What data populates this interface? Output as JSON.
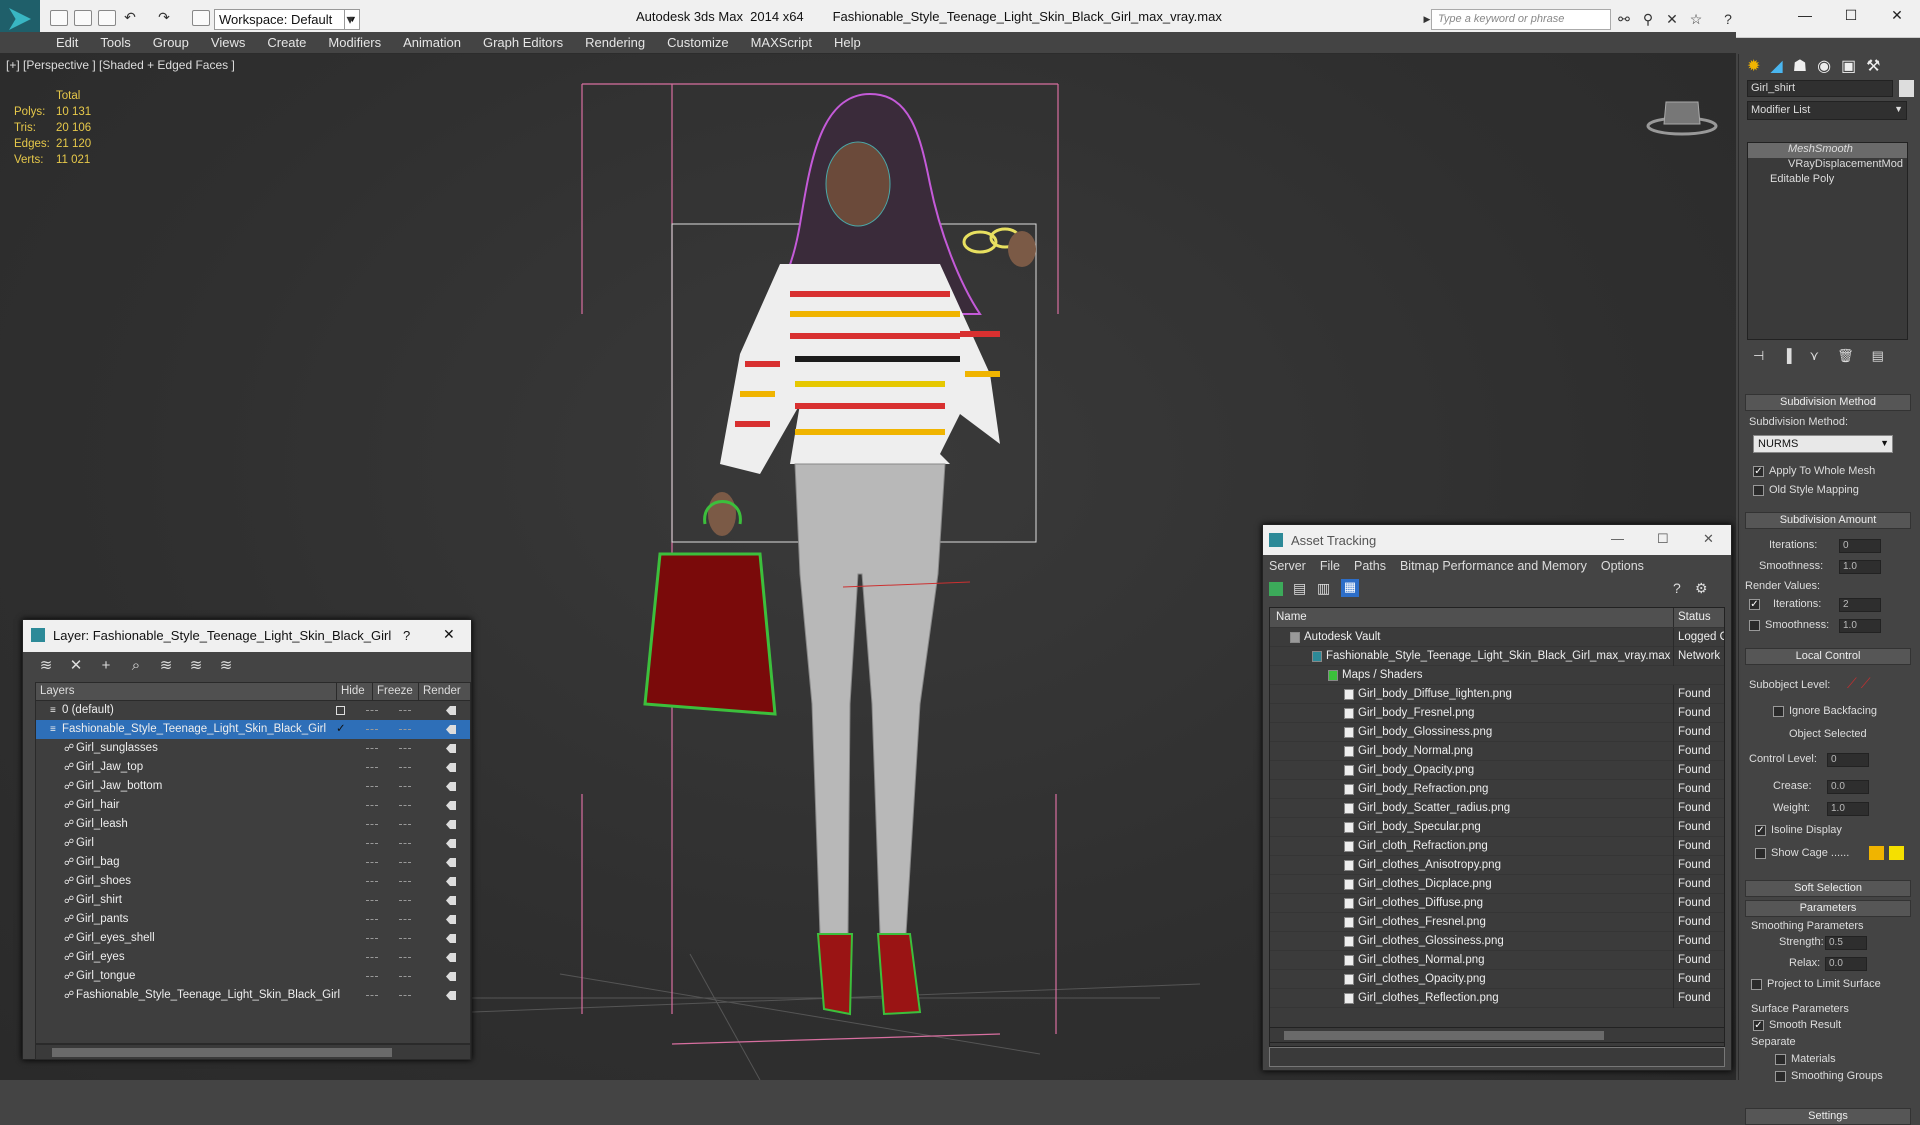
{
  "title_bar": {
    "app_title": "Autodesk 3ds Max  2014 x64",
    "file_title": "Fashionable_Style_Teenage_Light_Skin_Black_Girl_max_vray.max",
    "workspace": "Workspace: Default",
    "search_placeholder": "Type a keyword or phrase"
  },
  "menu": [
    "Edit",
    "Tools",
    "Group",
    "Views",
    "Create",
    "Modifiers",
    "Animation",
    "Graph Editors",
    "Rendering",
    "Customize",
    "MAXScript",
    "Help"
  ],
  "viewport": {
    "label": "[+] [Perspective ] [Shaded + Edged Faces ]",
    "stats": {
      "header": "Total",
      "rows": [
        {
          "k": "Polys:",
          "v": "10 131"
        },
        {
          "k": "Tris:",
          "v": "20 106"
        },
        {
          "k": "Edges:",
          "v": "21 120"
        },
        {
          "k": "Verts:",
          "v": "11 021"
        }
      ]
    }
  },
  "command_panel": {
    "object_name": "Girl_shirt",
    "modifier_list": "Modifier List",
    "stack": [
      "MeshSmooth",
      "VRayDisplacementMod",
      "Editable Poly"
    ],
    "subdivision_method_title": "Subdivision Method",
    "subdivision_method_label": "Subdivision Method:",
    "subdivision_method_value": "NURMS",
    "apply_whole_mesh": "Apply To Whole Mesh",
    "old_style_mapping": "Old Style Mapping",
    "subdivision_amount_title": "Subdivision Amount",
    "iterations_label": "Iterations:",
    "iterations_value": "0",
    "smoothness_label": "Smoothness:",
    "smoothness_value": "1.0",
    "render_values": "Render Values:",
    "render_iterations_value": "2",
    "render_smoothness_value": "1.0",
    "local_control_title": "Local Control",
    "subobject_level": "Subobject Level:",
    "ignore_backfacing": "Ignore Backfacing",
    "object_selected": "Object Selected",
    "control_level_label": "Control Level:",
    "control_level_value": "0",
    "crease_label": "Crease:",
    "crease_value": "0.0",
    "weight_label": "Weight:",
    "weight_value": "1.0",
    "isoline_display": "Isoline Display",
    "show_cage": "Show Cage ......",
    "soft_selection_title": "Soft Selection",
    "parameters_title": "Parameters",
    "smoothing_parameters": "Smoothing Parameters",
    "strength_label": "Strength:",
    "strength_value": "0.5",
    "relax_label": "Relax:",
    "relax_value": "0.0",
    "project_limit": "Project to Limit Surface",
    "surface_parameters": "Surface Parameters",
    "smooth_result": "Smooth Result",
    "separate": "Separate",
    "materials": "Materials",
    "smoothing_groups": "Smoothing Groups",
    "settings_title": "Settings",
    "cage_colors": [
      "#f0b400",
      "#f5e000"
    ]
  },
  "layer_dialog": {
    "title": "Layer: Fashionable_Style_Teenage_Light_Skin_Black_Girl",
    "help": "?",
    "columns": {
      "layers": "Layers",
      "hide": "Hide",
      "freeze": "Freeze",
      "render": "Render"
    },
    "rows": [
      {
        "name": "0 (default)"
      },
      {
        "name": "Fashionable_Style_Teenage_Light_Skin_Black_Girl"
      },
      {
        "name": "Girl_sunglasses"
      },
      {
        "name": "Girl_Jaw_top"
      },
      {
        "name": "Girl_Jaw_bottom"
      },
      {
        "name": "Girl_hair"
      },
      {
        "name": "Girl_leash"
      },
      {
        "name": "Girl"
      },
      {
        "name": "Girl_bag"
      },
      {
        "name": "Girl_shoes"
      },
      {
        "name": "Girl_shirt"
      },
      {
        "name": "Girl_pants"
      },
      {
        "name": "Girl_eyes_shell"
      },
      {
        "name": "Girl_eyes"
      },
      {
        "name": "Girl_tongue"
      },
      {
        "name": "Fashionable_Style_Teenage_Light_Skin_Black_Girl"
      }
    ]
  },
  "asset_dialog": {
    "title": "Asset Tracking",
    "menu": [
      "Server",
      "File",
      "Paths",
      "Bitmap Performance and Memory",
      "Options"
    ],
    "columns": {
      "name": "Name",
      "status": "Status"
    },
    "rows": [
      {
        "name": "Autodesk Vault",
        "status": "Logged Out"
      },
      {
        "name": "Fashionable_Style_Teenage_Light_Skin_Black_Girl_max_vray.max",
        "status": "Network Path"
      },
      {
        "name": "Maps / Shaders",
        "status": ""
      },
      {
        "name": "Girl_body_Diffuse_lighten.png",
        "status": "Found"
      },
      {
        "name": "Girl_body_Fresnel.png",
        "status": "Found"
      },
      {
        "name": "Girl_body_Glossiness.png",
        "status": "Found"
      },
      {
        "name": "Girl_body_Normal.png",
        "status": "Found"
      },
      {
        "name": "Girl_body_Opacity.png",
        "status": "Found"
      },
      {
        "name": "Girl_body_Refraction.png",
        "status": "Found"
      },
      {
        "name": "Girl_body_Scatter_radius.png",
        "status": "Found"
      },
      {
        "name": "Girl_body_Specular.png",
        "status": "Found"
      },
      {
        "name": "Girl_cloth_Refraction.png",
        "status": "Found"
      },
      {
        "name": "Girl_clothes_Anisotropy.png",
        "status": "Found"
      },
      {
        "name": "Girl_clothes_Dicplace.png",
        "status": "Found"
      },
      {
        "name": "Girl_clothes_Diffuse.png",
        "status": "Found"
      },
      {
        "name": "Girl_clothes_Fresnel.png",
        "status": "Found"
      },
      {
        "name": "Girl_clothes_Glossiness.png",
        "status": "Found"
      },
      {
        "name": "Girl_clothes_Normal.png",
        "status": "Found"
      },
      {
        "name": "Girl_clothes_Opacity.png",
        "status": "Found"
      },
      {
        "name": "Girl_clothes_Reflection.png",
        "status": "Found"
      }
    ]
  }
}
